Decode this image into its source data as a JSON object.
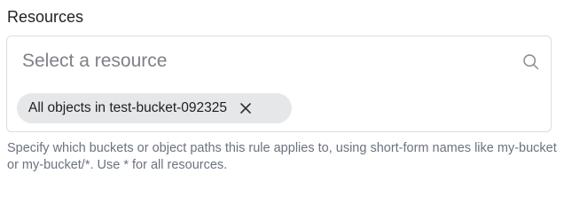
{
  "field": {
    "label": "Resources",
    "placeholder": "Select a resource",
    "selected_chips": [
      {
        "label": "All objects in test-bucket-092325"
      }
    ],
    "help_text": "Specify which buckets or object paths this rule applies to, using short-form names like my-bucket or my-bucket/*. Use * for all resources."
  },
  "icons": {
    "search": "search-icon",
    "remove": "close-icon"
  }
}
